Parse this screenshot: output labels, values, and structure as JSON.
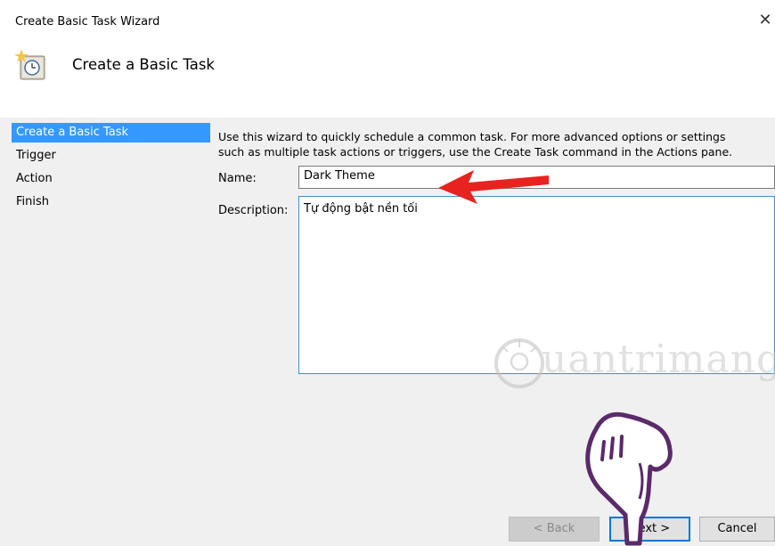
{
  "window": {
    "title": "Create Basic Task Wizard",
    "close_icon_glyph": "✕"
  },
  "header": {
    "title": "Create a Basic Task",
    "icon": "task-scheduler-clock-icon"
  },
  "nav": {
    "items": [
      {
        "label": "Create a Basic Task",
        "selected": true
      },
      {
        "label": "Trigger",
        "selected": false
      },
      {
        "label": "Action",
        "selected": false
      },
      {
        "label": "Finish",
        "selected": false
      }
    ]
  },
  "form": {
    "intro_line1": "Use this wizard to quickly schedule a common task.  For more advanced options or settings",
    "intro_line2": "such as multiple task actions or triggers, use the Create Task command in the Actions pane.",
    "name_label": "Name:",
    "name_value": "Dark Theme",
    "description_label": "Description:",
    "description_value": "Tự động bật nền tối"
  },
  "buttons": {
    "back": "< Back",
    "next": "Next >",
    "cancel": "Cancel"
  },
  "overlay": {
    "watermark": "uantrimang",
    "arrow_color": "#e8231f"
  }
}
